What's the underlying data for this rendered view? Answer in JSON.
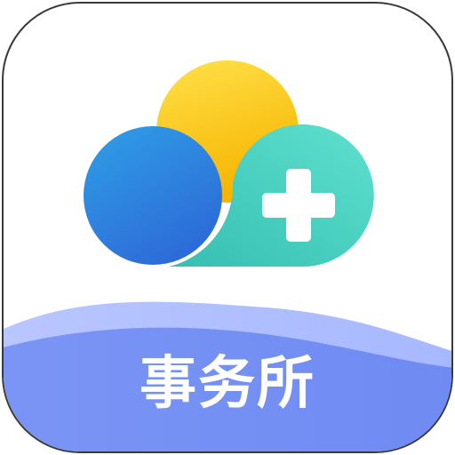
{
  "app_icon": {
    "label": "事务所",
    "badge_icon": "plus-icon",
    "colors": {
      "background": "#FFFFFF",
      "border": "#3A3A3A",
      "sun_light": "#FFE14A",
      "sun_dark": "#F7B500",
      "blue_light": "#2FA0E6",
      "blue_dark": "#2D6BD8",
      "teal_light": "#5FE0CE",
      "teal_dark": "#35BFB2",
      "wave_light": "#A7B8FF",
      "wave_dark": "#6F8BF3",
      "plus": "#FFFFFF",
      "label_text": "#FFFFFF"
    }
  }
}
